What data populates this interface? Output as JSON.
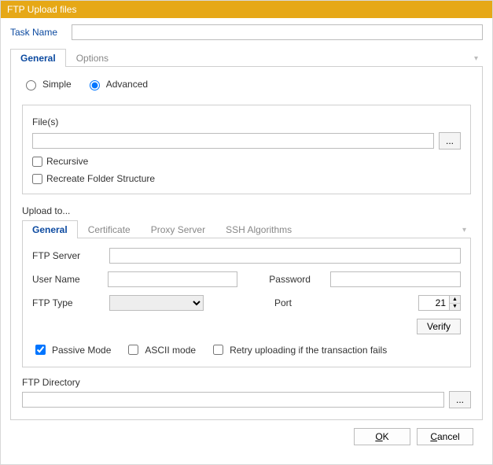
{
  "window": {
    "title": "FTP Upload files"
  },
  "task": {
    "label": "Task Name",
    "value": ""
  },
  "tabs": {
    "general": "General",
    "options": "Options"
  },
  "mode": {
    "simple": "Simple",
    "advanced": "Advanced",
    "selected": "advanced"
  },
  "files": {
    "legend": "File(s)",
    "value": "",
    "browse": "...",
    "recursive": "Recursive",
    "recreate": "Recreate Folder Structure"
  },
  "upload": {
    "legend": "Upload to...",
    "tabs": {
      "general": "General",
      "certificate": "Certificate",
      "proxy": "Proxy Server",
      "ssh": "SSH Algorithms"
    },
    "ftp_server_label": "FTP Server",
    "ftp_server_value": "",
    "username_label": "User Name",
    "username_value": "",
    "password_label": "Password",
    "password_value": "",
    "ftp_type_label": "FTP Type",
    "ftp_type_value": "",
    "port_label": "Port",
    "port_value": "21",
    "verify_label": "Verify",
    "passive_label": "Passive Mode",
    "passive_checked": true,
    "ascii_label": "ASCII mode",
    "ascii_checked": false,
    "retry_label": "Retry uploading if the transaction fails",
    "retry_checked": false
  },
  "ftp_dir": {
    "label": "FTP Directory",
    "value": "",
    "browse": "..."
  },
  "footer": {
    "ok": "OK",
    "cancel": "Cancel",
    "ok_u": "O",
    "ok_rest": "K",
    "cancel_u": "C",
    "cancel_rest": "ancel"
  }
}
